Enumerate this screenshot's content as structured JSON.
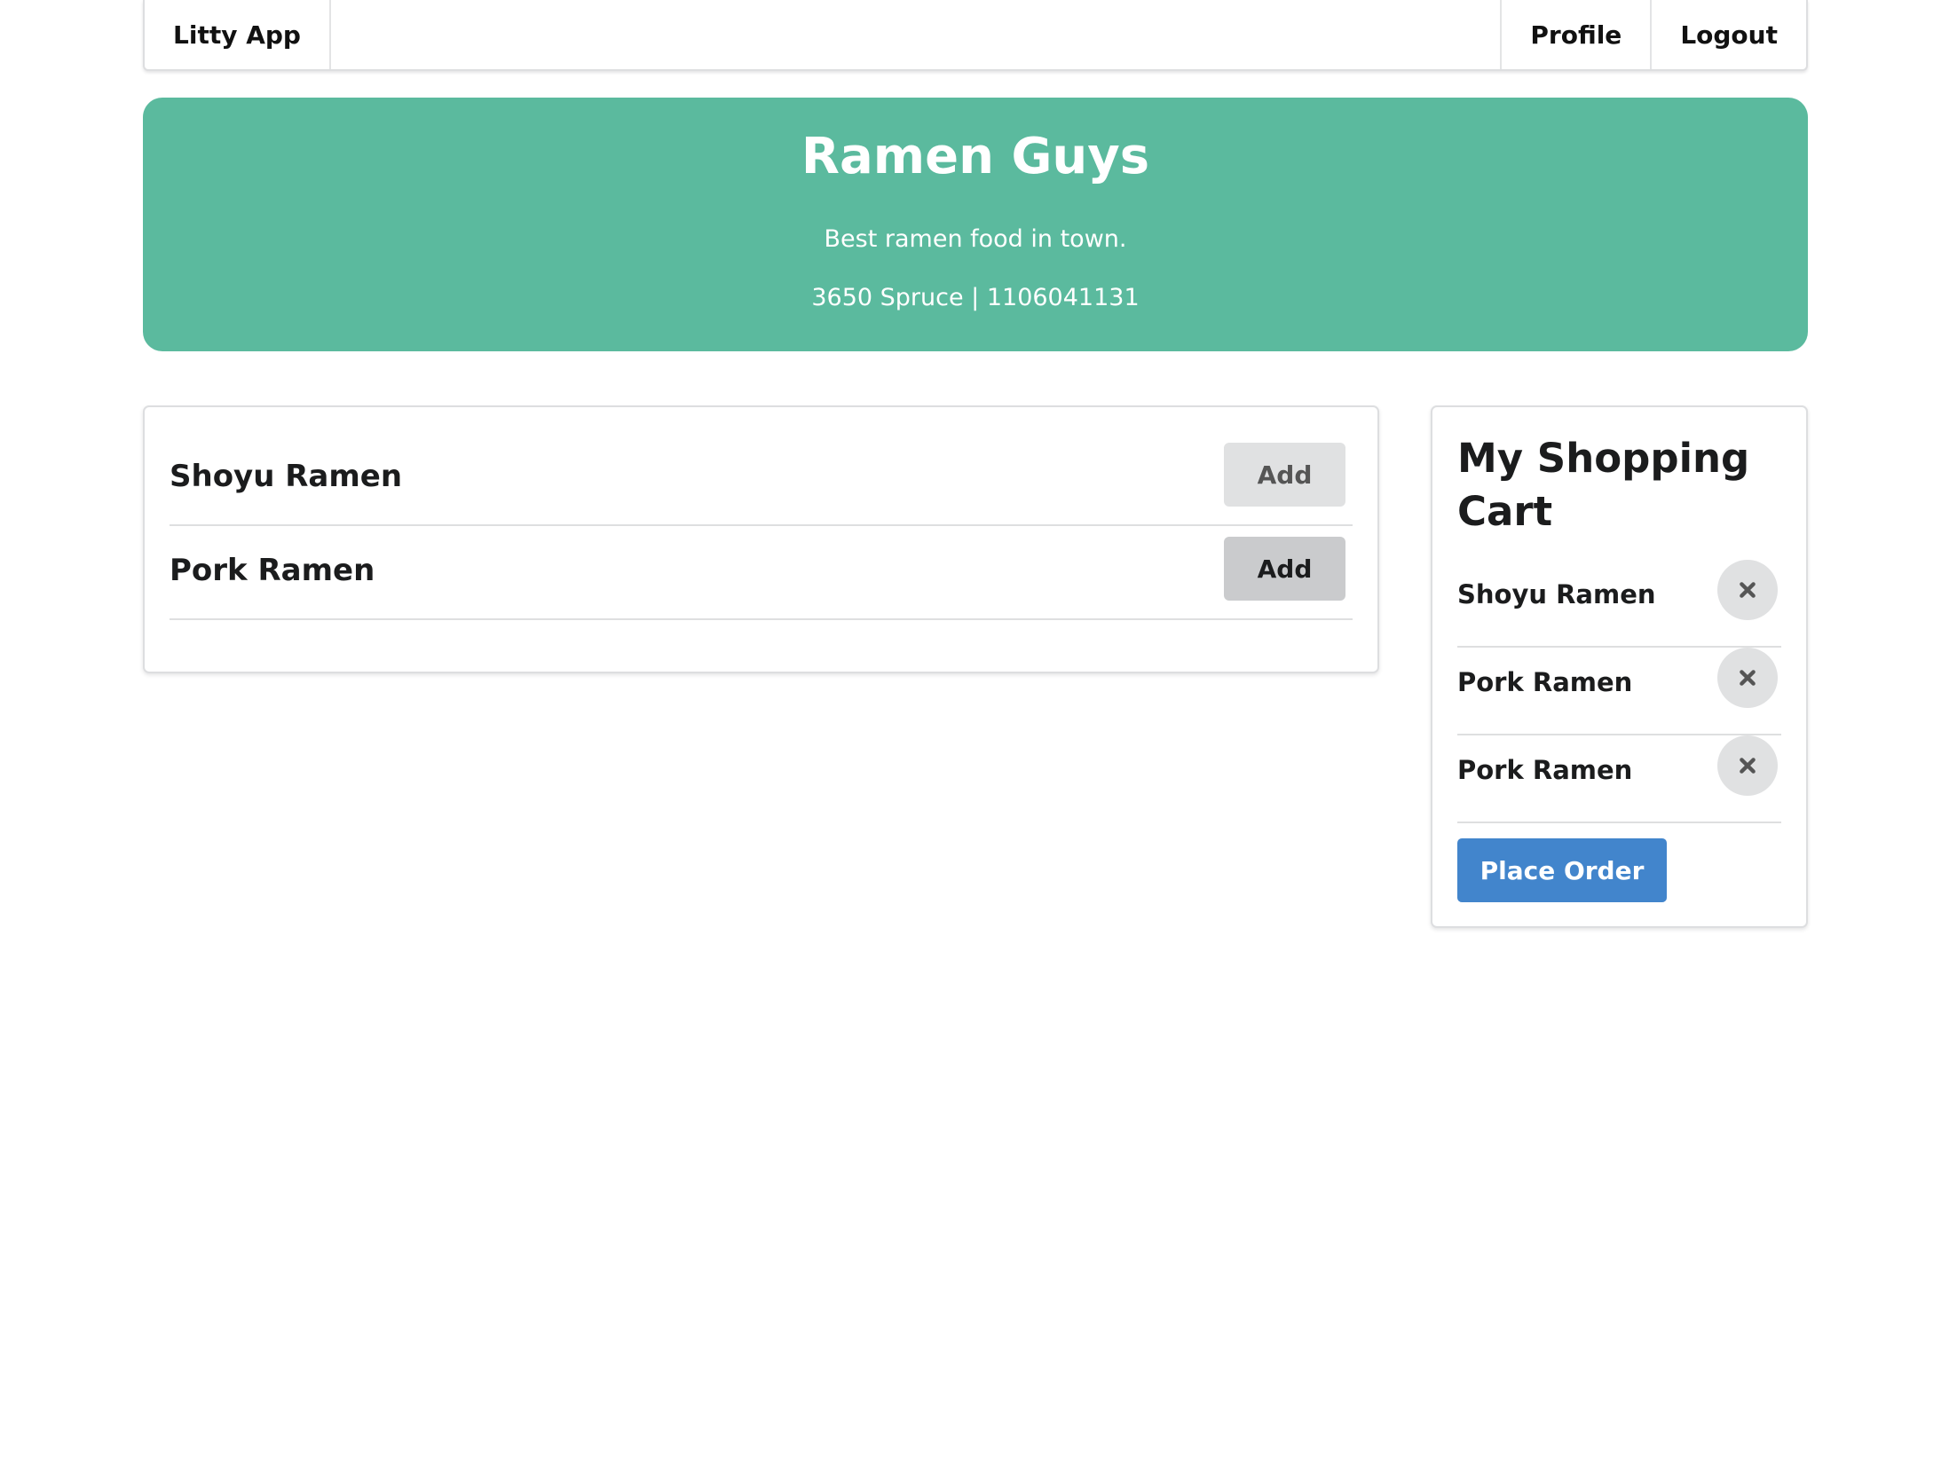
{
  "navbar": {
    "brand": "Litty App",
    "profile": "Profile",
    "logout": "Logout"
  },
  "restaurant": {
    "name": "Ramen Guys",
    "description": "Best ramen food in town.",
    "contact": "3650 Spruce | 1106041131",
    "banner_color": "#5bba9e"
  },
  "menu": {
    "items": [
      {
        "name": "Shoyu Ramen",
        "action": "Add"
      },
      {
        "name": "Pork Ramen",
        "action": "Add"
      }
    ]
  },
  "cart": {
    "title": "My Shopping Cart",
    "items": [
      {
        "name": "Shoyu Ramen",
        "remove_icon": "close-icon"
      },
      {
        "name": "Pork Ramen",
        "remove_icon": "close-icon"
      },
      {
        "name": "Pork Ramen",
        "remove_icon": "close-icon"
      }
    ],
    "place_order": "Place Order",
    "button_color": "#4285cc"
  }
}
